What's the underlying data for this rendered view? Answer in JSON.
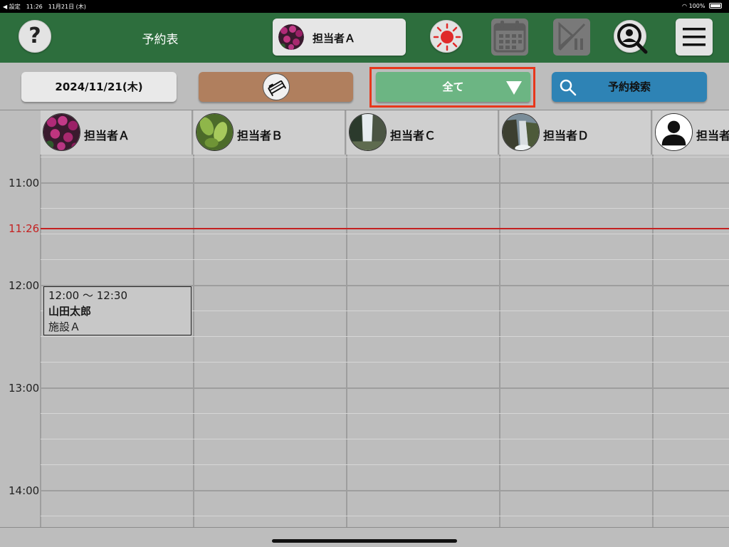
{
  "status_bar": {
    "left": "◀ 設定　11:26　11月21日 (木)",
    "battery": "100%"
  },
  "header": {
    "help_label": "?",
    "title": "予約表",
    "selected_staff": "担当者Ａ",
    "icons": [
      "sun-icon",
      "calendar-icon",
      "play-pause-icon",
      "user-search-icon",
      "menu-icon"
    ]
  },
  "toolbar": {
    "date_label": "2024/11/21(木)",
    "facility_icon": "bed-icon",
    "filter_label": "全て",
    "search_label": "予約検索"
  },
  "staff_columns": [
    {
      "name": "担当者Ａ",
      "avatar": "purple-flowers"
    },
    {
      "name": "担当者Ｂ",
      "avatar": "green-leaves"
    },
    {
      "name": "担当者Ｃ",
      "avatar": "waterfall"
    },
    {
      "name": "担当者Ｄ",
      "avatar": "waterfall-cliff"
    },
    {
      "name": "担当者Ｅ",
      "avatar": "person-silhouette"
    }
  ],
  "time_labels": [
    "11:00",
    "12:00",
    "13:00",
    "14:00"
  ],
  "current_time": "11:26",
  "appointments": [
    {
      "time": "12:00 〜 12:30",
      "name": "山田太郎",
      "facility": "施設Ａ",
      "staff": "担当者Ａ"
    }
  ],
  "colors": {
    "header_green": "#2d6e3d",
    "filter_green": "#6cb583",
    "search_blue": "#2e83b5",
    "facility_brown": "#b07f5e",
    "now_line_red": "#c42121",
    "highlight_orange": "#e8371c"
  }
}
